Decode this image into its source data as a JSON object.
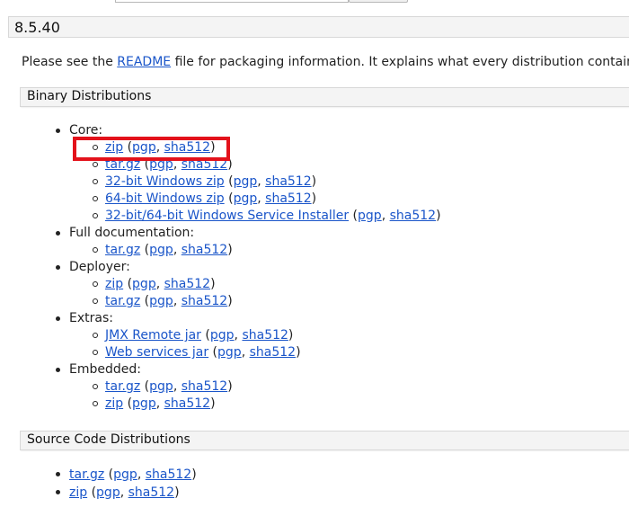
{
  "version": "8.5.40",
  "intro": {
    "before": "Please see the ",
    "link": "README",
    "after": " file for packaging information. It explains what every distribution contains."
  },
  "binary_title": "Binary Distributions",
  "groups": [
    {
      "label": "Core:",
      "items": [
        {
          "link": "zip",
          "pgp": "pgp",
          "sha": "sha512"
        },
        {
          "link": "tar.gz",
          "pgp": "pgp",
          "sha": "sha512"
        },
        {
          "link": "32-bit Windows zip",
          "pgp": "pgp",
          "sha": "sha512"
        },
        {
          "link": "64-bit Windows zip",
          "pgp": "pgp",
          "sha": "sha512"
        },
        {
          "link": "32-bit/64-bit Windows Service Installer",
          "pgp": "pgp",
          "sha": "sha512"
        }
      ]
    },
    {
      "label": "Full documentation:",
      "items": [
        {
          "link": "tar.gz",
          "pgp": "pgp",
          "sha": "sha512"
        }
      ]
    },
    {
      "label": "Deployer:",
      "items": [
        {
          "link": "zip",
          "pgp": "pgp",
          "sha": "sha512"
        },
        {
          "link": "tar.gz",
          "pgp": "pgp",
          "sha": "sha512"
        }
      ]
    },
    {
      "label": "Extras:",
      "items": [
        {
          "link": "JMX Remote jar",
          "pgp": "pgp",
          "sha": "sha512"
        },
        {
          "link": "Web services jar",
          "pgp": "pgp",
          "sha": "sha512"
        }
      ]
    },
    {
      "label": "Embedded:",
      "items": [
        {
          "link": "tar.gz",
          "pgp": "pgp",
          "sha": "sha512"
        },
        {
          "link": "zip",
          "pgp": "pgp",
          "sha": "sha512"
        }
      ]
    }
  ],
  "source_title": "Source Code Distributions",
  "source_items": [
    {
      "link": "tar.gz",
      "pgp": "pgp",
      "sha": "sha512"
    },
    {
      "link": "zip",
      "pgp": "pgp",
      "sha": "sha512"
    }
  ],
  "punct": {
    "open": " (",
    "comma": ", ",
    "close": ")"
  },
  "colors": {
    "link": "#1a55c9",
    "highlight": "#e3121b",
    "bar_bg": "#f4f4f4"
  }
}
